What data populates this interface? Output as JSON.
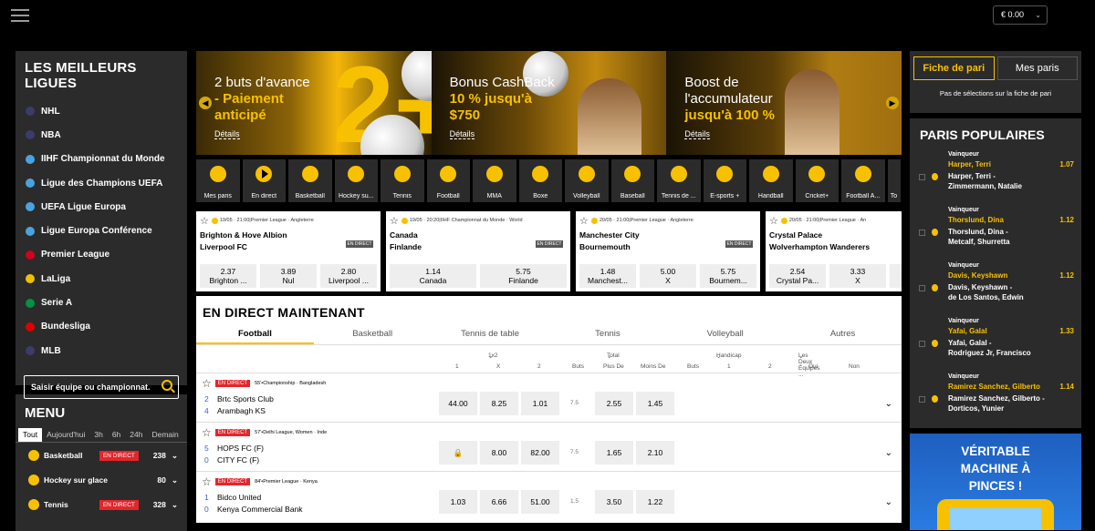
{
  "header": {
    "balance": "€ 0.00"
  },
  "leagues": {
    "title": "LES MEILLEURS LIGUES",
    "items": [
      {
        "label": "NHL",
        "flag": "#3c3b6e"
      },
      {
        "label": "NBA",
        "flag": "#3c3b6e"
      },
      {
        "label": "IIHF Championnat du Monde",
        "flag": "#4aa3df"
      },
      {
        "label": "Ligue des Champions UEFA",
        "flag": "#4aa3df"
      },
      {
        "label": "UEFA Ligue Europa",
        "flag": "#4aa3df"
      },
      {
        "label": "Ligue Europa Conférence",
        "flag": "#4aa3df"
      },
      {
        "label": "Premier League",
        "flag": "#d0021b"
      },
      {
        "label": "LaLiga",
        "flag": "#f1bf00"
      },
      {
        "label": "Serie A",
        "flag": "#009246"
      },
      {
        "label": "Bundesliga",
        "flag": "#dd0000"
      },
      {
        "label": "MLB",
        "flag": "#3c3b6e"
      }
    ],
    "search_placeholder": "Saisir équipe ou championnat."
  },
  "menu": {
    "title": "MENU",
    "tabs": [
      "Tout",
      "Aujourd'hui",
      "3h",
      "6h",
      "24h",
      "Demain"
    ],
    "sports": [
      {
        "label": "Basketball",
        "badge": "EN DIRECT",
        "count": "238"
      },
      {
        "label": "Hockey sur glace",
        "badge": "",
        "count": "80"
      },
      {
        "label": "Tennis",
        "badge": "EN DIRECT",
        "count": "328"
      }
    ]
  },
  "banners": [
    {
      "line1": "2 buts d'avance",
      "line2": "- Paiement",
      "line3": "anticipé",
      "details": "Détails",
      "big": "2+"
    },
    {
      "line1": "Bonus CashBack",
      "line2": "10 % jusqu'à",
      "line3": "$750",
      "details": "Détails"
    },
    {
      "line1": "Boost de",
      "line1b": "l'accumulateur",
      "line2": "jusqu'à 100 %",
      "details": "Détails"
    }
  ],
  "sports_bar": [
    "Mes paris",
    "En direct",
    "Basketball",
    "Hockey su...",
    "Tennis",
    "Football",
    "MMA",
    "Boxe",
    "Volleyball",
    "Baseball",
    "Tennis de ...",
    "E-sports +",
    "Handball",
    "Cricket+",
    "Football A...",
    "To"
  ],
  "match_cards": [
    {
      "date": "19/05 · 21:00",
      "league": "Premier League · Angleterre",
      "home": "Brighton & Hove Albion",
      "away": "Liverpool FC",
      "stats": "EN DIRECT",
      "odds": [
        {
          "v": "2.37",
          "l": "Brighton ..."
        },
        {
          "v": "3.89",
          "l": "Nul"
        },
        {
          "v": "2.80",
          "l": "Liverpool ..."
        }
      ]
    },
    {
      "date": "19/05 · 20:20",
      "league": "IIHF Championnat du Monde · World",
      "home": "Canada",
      "away": "Finlande",
      "stats": "EN DIRECT",
      "odds": [
        {
          "v": "1.14",
          "l": "Canada"
        },
        {
          "v": "5.75",
          "l": "Finlande"
        }
      ]
    },
    {
      "date": "20/05 · 21:00",
      "league": "Premier League · Angleterre",
      "home": "Manchester City",
      "away": "Bournemouth",
      "stats": "EN DIRECT",
      "odds": [
        {
          "v": "1.48",
          "l": "Manchest..."
        },
        {
          "v": "5.00",
          "l": "X"
        },
        {
          "v": "5.75",
          "l": "Bournem..."
        }
      ]
    },
    {
      "date": "20/05 · 21:00",
      "league": "Premier League · An",
      "home": "Crystal Palace",
      "away": "Wolverhampton Wanderers",
      "stats": "",
      "odds": [
        {
          "v": "2.54",
          "l": "Crystal Pa..."
        },
        {
          "v": "3.33",
          "l": "X"
        },
        {
          "v": "",
          "l": "W"
        }
      ]
    }
  ],
  "live": {
    "title": "EN DIRECT MAINTENANT",
    "tabs": [
      "Football",
      "Basketball",
      "Tennis de table",
      "Tennis",
      "Volleyball",
      "Autres"
    ],
    "market_headers": {
      "m1": "1x2",
      "m2": "Total",
      "m3": "Handicap",
      "m4": "Les Deux Équipes ..."
    },
    "sub_headers": {
      "c1": "1",
      "cx": "X",
      "c2": "2",
      "buts": "Buts",
      "plus": "Plus De",
      "moins": "Moins De",
      "buts2": "Buts",
      "h1": "1",
      "h2": "2",
      "oui": "Oui",
      "non": "Non"
    },
    "rows": [
      {
        "minute": "55'",
        "league": "Championship · Bangladesh",
        "badge": "EN DIRECT",
        "s1": "2",
        "t1": "Brtc Sports Club",
        "s2": "4",
        "t2": "Arambagh KS",
        "o1": "44.00",
        "ox": "8.25",
        "o2": "1.01",
        "line": "7.5",
        "over": "2.55",
        "under": "1.45"
      },
      {
        "minute": "57'",
        "league": "Delhi League, Women · Inde",
        "badge": "EN DIRECT",
        "s1": "5",
        "t1": "HOPS FC (F)",
        "s2": "0",
        "t2": "CITY FC (F)",
        "o1": "🔒",
        "ox": "8.00",
        "o2": "82.00",
        "line": "7.5",
        "over": "1.65",
        "under": "2.10"
      },
      {
        "minute": "84'",
        "league": "Premier League · Kenya",
        "badge": "EN DIRECT",
        "s1": "1",
        "t1": "Bidco United",
        "s2": "0",
        "t2": "Kenya Commercial Bank",
        "o1": "1.03",
        "ox": "6.66",
        "o2": "51.00",
        "line": "1.5",
        "over": "3.50",
        "under": "1.22"
      }
    ]
  },
  "betslip": {
    "tab_active": "Fiche de pari",
    "tab_other": "Mes paris",
    "empty": "Pas de sélections sur la fiche de pari"
  },
  "popular": {
    "title": "PARIS POPULAIRES",
    "items": [
      {
        "type": "Vainqueur",
        "name": "Harper, Terri",
        "odd": "1.07",
        "match1": "Harper, Terri  -",
        "match2": "Zimmermann, Natalie"
      },
      {
        "type": "Vainqueur",
        "name": "Thorslund, Dina",
        "odd": "1.12",
        "match1": "Thorslund, Dina  -",
        "match2": "Metcalf, Shurretta"
      },
      {
        "type": "Vainqueur",
        "name": "Davis, Keyshawn",
        "odd": "1.12",
        "match1": "Davis, Keyshawn  -",
        "match2": "de Los Santos, Edwin"
      },
      {
        "type": "Vainqueur",
        "name": "Yafai, Galal",
        "odd": "1.33",
        "match1": "Yafai, Galal  -",
        "match2": "Rodriguez Jr, Francisco"
      },
      {
        "type": "Vainqueur",
        "name": "Ramirez Sanchez, Gilberto",
        "odd": "1.14",
        "match1": "Ramirez Sanchez, Gilberto  -",
        "match2": "Dorticos, Yunier"
      }
    ]
  },
  "ad": {
    "line1": "VÉRITABLE",
    "line2": "MACHINE À",
    "line3": "PINCES !"
  }
}
